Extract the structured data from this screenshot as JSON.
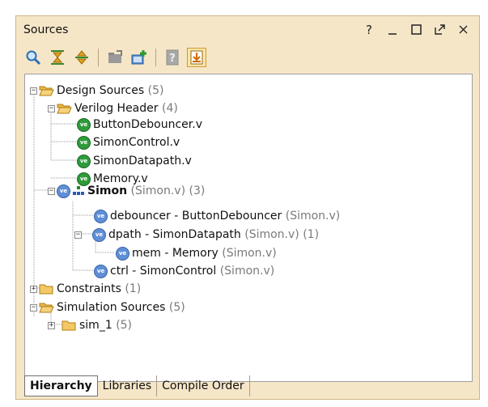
{
  "panel": {
    "title": "Sources",
    "window_controls": {
      "help": "?",
      "minimize": "_",
      "maximize": "□",
      "float": "⇱",
      "close": "×"
    }
  },
  "toolbar": {
    "items": [
      "search-icon",
      "collapse-all-icon",
      "expand-all-icon",
      "add-sources-disabled-icon",
      "add-sources-icon",
      "help-disabled-icon",
      "show-hierarchy-icon"
    ]
  },
  "tree": {
    "design_sources": {
      "label": "Design Sources",
      "count": "(5)"
    },
    "verilog_header": {
      "label": "Verilog Header",
      "count": "(4)"
    },
    "file1": "ButtonDebouncer.v",
    "file2": "SimonControl.v",
    "file3": "SimonDatapath.v",
    "file4": "Memory.v",
    "top": {
      "label": "Simon",
      "source": "(Simon.v)",
      "count": "(3)"
    },
    "debouncer": {
      "label": "debouncer - ButtonDebouncer",
      "source": "(Simon.v)"
    },
    "dpath": {
      "label": "dpath - SimonDatapath",
      "source": "(Simon.v)",
      "count": "(1)"
    },
    "mem": {
      "label": "mem - Memory",
      "source": "(Simon.v)"
    },
    "ctrl": {
      "label": "ctrl - SimonControl",
      "source": "(Simon.v)"
    },
    "constraints": {
      "label": "Constraints",
      "count": "(1)"
    },
    "sim_sources": {
      "label": "Simulation Sources",
      "count": "(5)"
    },
    "sim_1": {
      "label": "sim_1",
      "count": "(5)"
    }
  },
  "tabs": [
    "Hierarchy",
    "Libraries",
    "Compile Order"
  ],
  "active_tab": "Hierarchy"
}
